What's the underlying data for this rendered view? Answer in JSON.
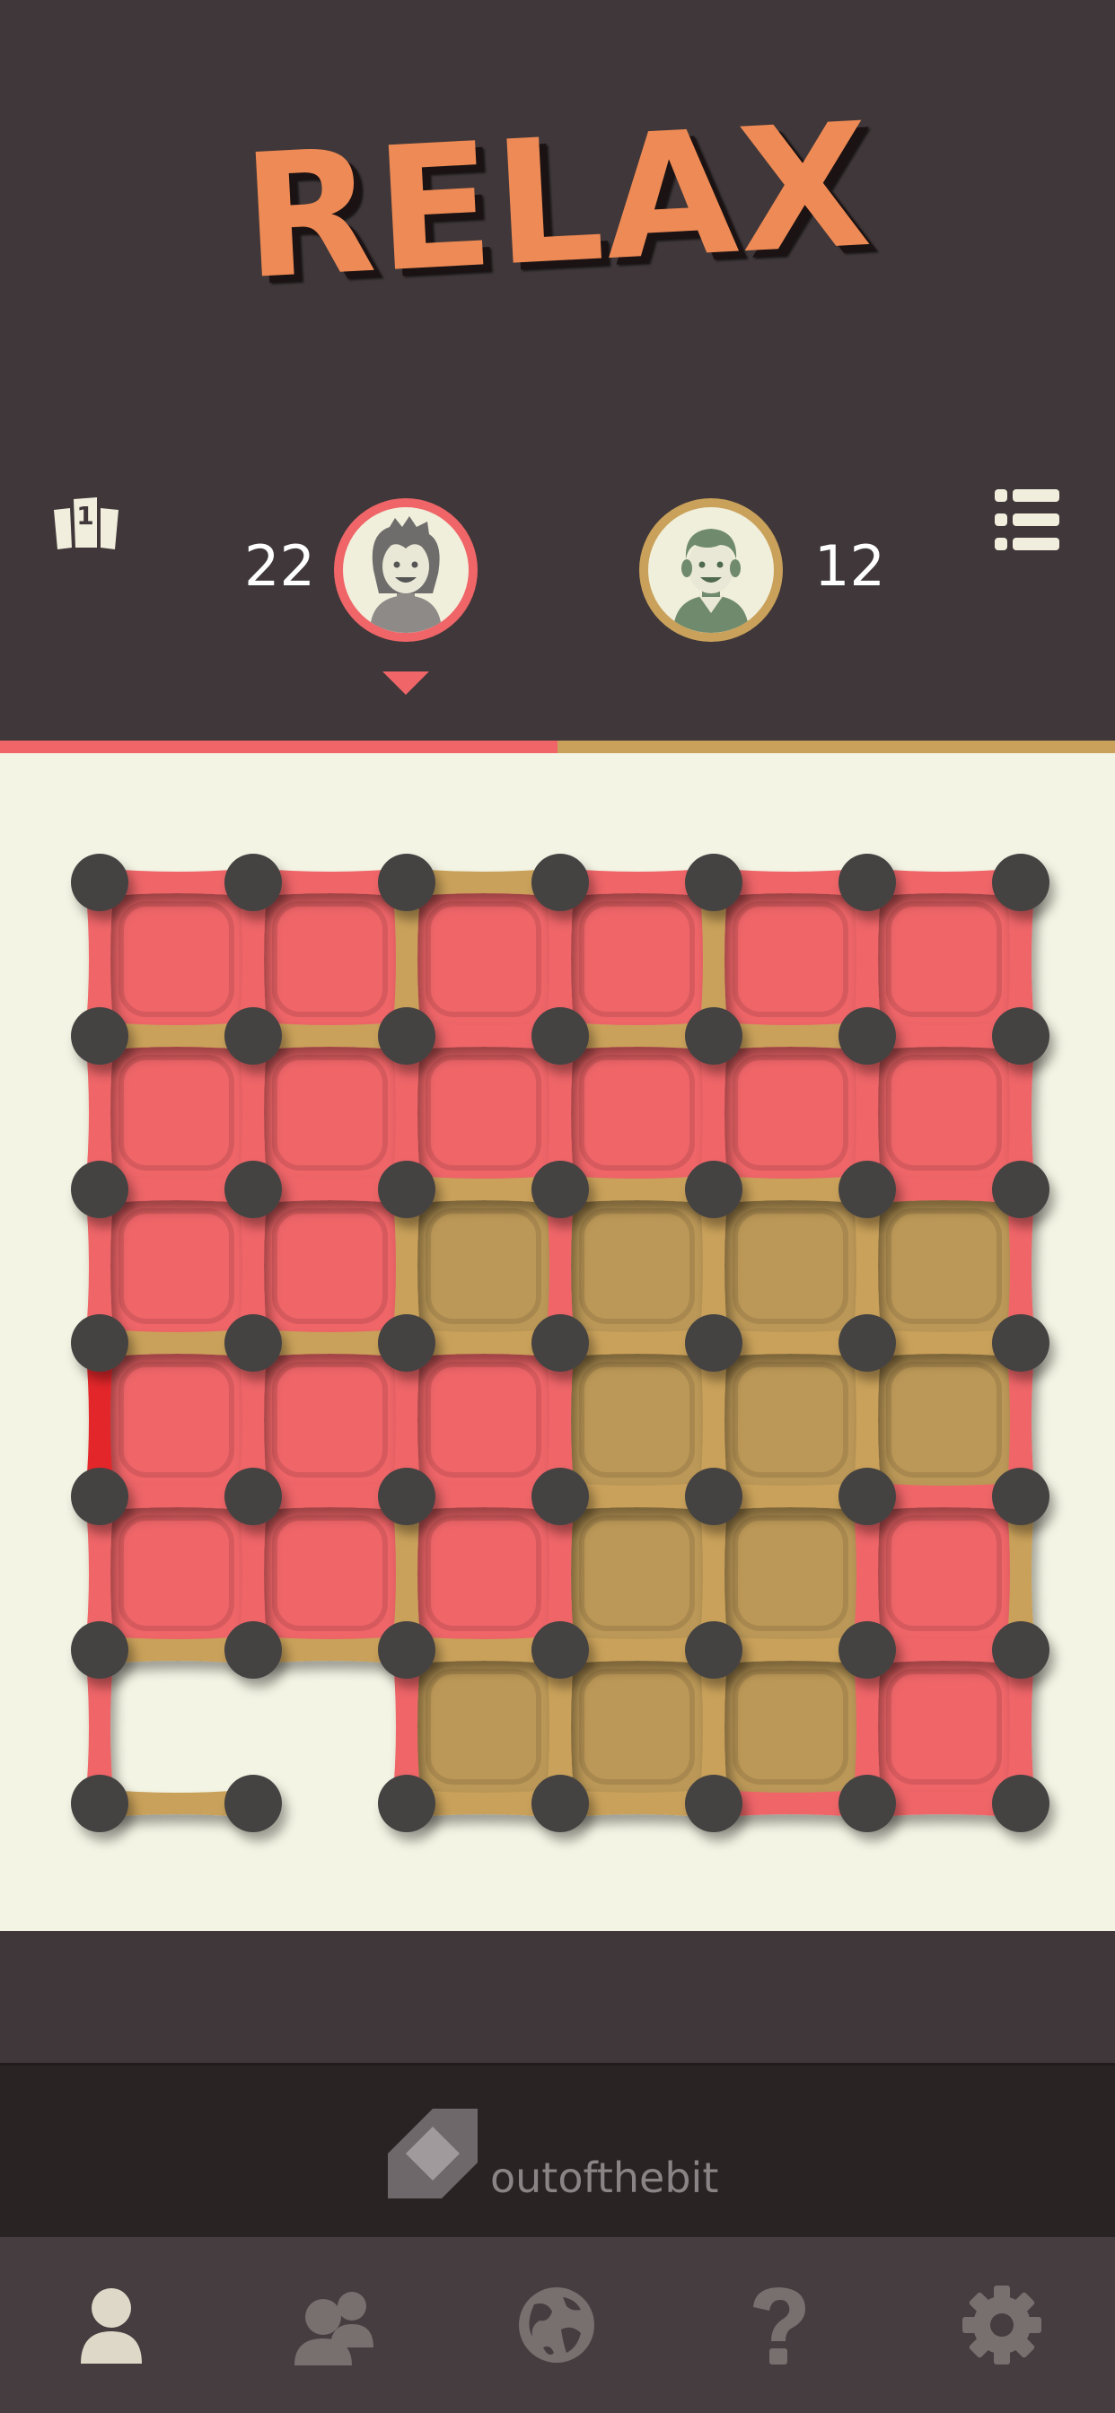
{
  "game": {
    "title": "RELAX",
    "player1": {
      "score": "22",
      "color": "#ef6568",
      "active": true
    },
    "player2": {
      "score": "12",
      "color": "#c9a15a",
      "active": false
    }
  },
  "colors": {
    "background": "#3f3739",
    "board_bg": "#f4f4e4",
    "red": "#ef6568",
    "gold": "#c9a15a",
    "gold_box": "#bb9857",
    "dot": "#454343",
    "last_move": "#e3262c"
  },
  "brand": {
    "name": "outofthebit"
  },
  "icons": {
    "leaderboard": "podium-icon",
    "menu": "list-icon",
    "tabs": [
      "single-player-icon",
      "multiplayer-icon",
      "globe-icon",
      "help-icon",
      "settings-icon"
    ]
  },
  "board": {
    "dots": 7,
    "boxes": [
      [
        "r",
        "r",
        "r",
        "r",
        "r",
        "r"
      ],
      [
        "r",
        "r",
        "r",
        "r",
        "r",
        "r"
      ],
      [
        "r",
        "r",
        "g",
        "g",
        "g",
        "g"
      ],
      [
        "r",
        "r",
        "r",
        "g",
        "g",
        "g"
      ],
      [
        "r",
        "r",
        "r",
        "g",
        "g",
        "r"
      ],
      [
        "",
        "",
        "g",
        "g",
        "g",
        "r"
      ]
    ],
    "hlines": [
      [
        "r",
        "r",
        "g",
        "r",
        "r",
        "r"
      ],
      [
        "g",
        "g",
        "r",
        "g",
        "g",
        "r"
      ],
      [
        "r",
        "r",
        "g",
        "g",
        "g",
        "r"
      ],
      [
        "g",
        "g",
        "g",
        "g",
        "g",
        "g"
      ],
      [
        "r",
        "r",
        "r",
        "g",
        "g",
        "r"
      ],
      [
        "g",
        "g",
        "g",
        "g",
        "g",
        "r"
      ],
      [
        "g",
        "",
        "g",
        "g",
        "r",
        "r"
      ]
    ],
    "vlines": [
      [
        "r",
        "r",
        "g",
        "r",
        "g",
        "r",
        "r"
      ],
      [
        "r",
        "r",
        "r",
        "r",
        "r",
        "r",
        "r"
      ],
      [
        "r",
        "r",
        "g",
        "r",
        "g",
        "g",
        "r"
      ],
      [
        "x",
        "r",
        "r",
        "r",
        "g",
        "g",
        "r"
      ],
      [
        "r",
        "r",
        "g",
        "r",
        "g",
        "r",
        "g"
      ],
      [
        "r",
        "",
        "r",
        "g",
        "g",
        "r",
        "r"
      ]
    ]
  }
}
